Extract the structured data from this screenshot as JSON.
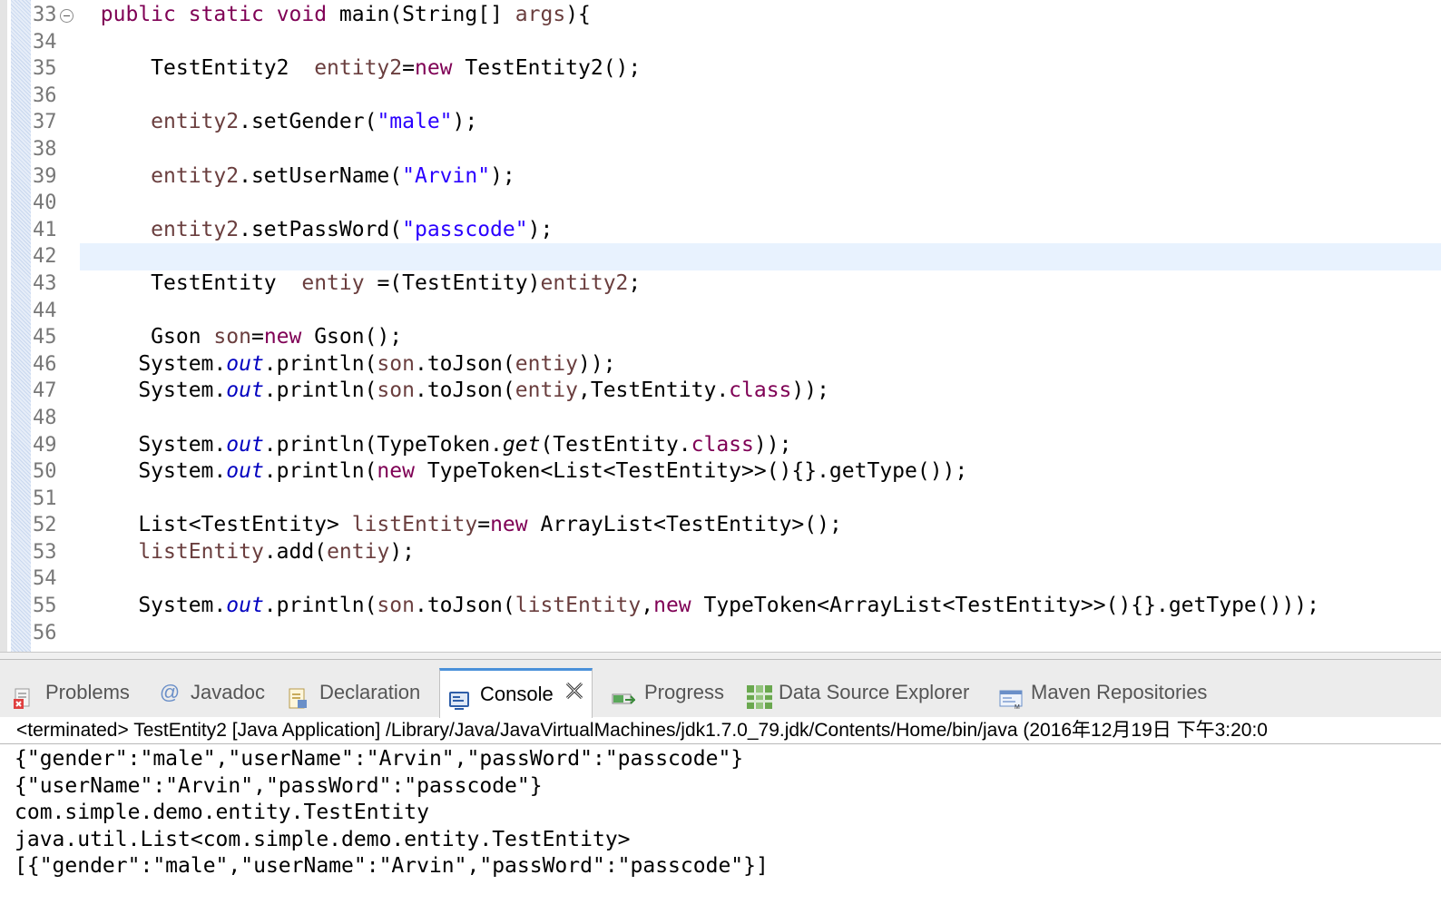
{
  "editor": {
    "lines": [
      {
        "n": "33",
        "tokens": [
          {
            "t": "        "
          },
          {
            "t": "public",
            "c": "kw"
          },
          {
            "t": " "
          },
          {
            "t": "static",
            "c": "kw"
          },
          {
            "t": " "
          },
          {
            "t": "void",
            "c": "kw"
          },
          {
            "t": " main(String[] "
          },
          {
            "t": "args",
            "c": "var"
          },
          {
            "t": "){"
          }
        ]
      },
      {
        "n": "34",
        "tokens": []
      },
      {
        "n": "35",
        "tokens": [
          {
            "t": "            TestEntity2  "
          },
          {
            "t": "entity2",
            "c": "var"
          },
          {
            "t": "="
          },
          {
            "t": "new",
            "c": "kw"
          },
          {
            "t": " TestEntity2();"
          }
        ]
      },
      {
        "n": "36",
        "tokens": []
      },
      {
        "n": "37",
        "tokens": [
          {
            "t": "            "
          },
          {
            "t": "entity2",
            "c": "var"
          },
          {
            "t": ".setGender("
          },
          {
            "t": "\"male\"",
            "c": "str"
          },
          {
            "t": ");"
          }
        ]
      },
      {
        "n": "38",
        "tokens": []
      },
      {
        "n": "39",
        "tokens": [
          {
            "t": "            "
          },
          {
            "t": "entity2",
            "c": "var"
          },
          {
            "t": ".setUserName("
          },
          {
            "t": "\"Arvin\"",
            "c": "str"
          },
          {
            "t": ");"
          }
        ]
      },
      {
        "n": "40",
        "tokens": []
      },
      {
        "n": "41",
        "tokens": [
          {
            "t": "            "
          },
          {
            "t": "entity2",
            "c": "var"
          },
          {
            "t": ".setPassWord("
          },
          {
            "t": "\"passcode\"",
            "c": "str"
          },
          {
            "t": ");"
          }
        ]
      },
      {
        "n": "42",
        "tokens": []
      },
      {
        "n": "43",
        "tokens": [
          {
            "t": "            TestEntity  "
          },
          {
            "t": "entiy",
            "c": "var"
          },
          {
            "t": " =(TestEntity)"
          },
          {
            "t": "entity2",
            "c": "var"
          },
          {
            "t": ";"
          }
        ]
      },
      {
        "n": "44",
        "tokens": []
      },
      {
        "n": "45",
        "tokens": [
          {
            "t": "            Gson "
          },
          {
            "t": "son",
            "c": "var"
          },
          {
            "t": "="
          },
          {
            "t": "new",
            "c": "kw"
          },
          {
            "t": " Gson();"
          }
        ]
      },
      {
        "n": "46",
        "tokens": [
          {
            "t": "           System."
          },
          {
            "t": "out",
            "c": "fld"
          },
          {
            "t": ".println("
          },
          {
            "t": "son",
            "c": "var"
          },
          {
            "t": ".toJson("
          },
          {
            "t": "entiy",
            "c": "var"
          },
          {
            "t": "));"
          }
        ]
      },
      {
        "n": "47",
        "tokens": [
          {
            "t": "           System."
          },
          {
            "t": "out",
            "c": "fld"
          },
          {
            "t": ".println("
          },
          {
            "t": "son",
            "c": "var"
          },
          {
            "t": ".toJson("
          },
          {
            "t": "entiy",
            "c": "var"
          },
          {
            "t": ",TestEntity."
          },
          {
            "t": "class",
            "c": "kw"
          },
          {
            "t": "));"
          }
        ]
      },
      {
        "n": "48",
        "tokens": []
      },
      {
        "n": "49",
        "tokens": [
          {
            "t": "           System."
          },
          {
            "t": "out",
            "c": "fld"
          },
          {
            "t": ".println(TypeToken."
          },
          {
            "t": "get",
            "c": "it"
          },
          {
            "t": "(TestEntity."
          },
          {
            "t": "class",
            "c": "kw"
          },
          {
            "t": "));"
          }
        ]
      },
      {
        "n": "50",
        "tokens": [
          {
            "t": "           System."
          },
          {
            "t": "out",
            "c": "fld"
          },
          {
            "t": ".println("
          },
          {
            "t": "new",
            "c": "kw"
          },
          {
            "t": " TypeToken<List<TestEntity>>(){}.getType());"
          }
        ]
      },
      {
        "n": "51",
        "tokens": []
      },
      {
        "n": "52",
        "tokens": [
          {
            "t": "           List<TestEntity> "
          },
          {
            "t": "listEntity",
            "c": "var"
          },
          {
            "t": "="
          },
          {
            "t": "new",
            "c": "kw"
          },
          {
            "t": " ArrayList<TestEntity>();"
          }
        ]
      },
      {
        "n": "53",
        "tokens": [
          {
            "t": "           "
          },
          {
            "t": "listEntity",
            "c": "var"
          },
          {
            "t": ".add("
          },
          {
            "t": "entiy",
            "c": "var"
          },
          {
            "t": ");"
          }
        ]
      },
      {
        "n": "54",
        "tokens": []
      },
      {
        "n": "55",
        "tokens": [
          {
            "t": "           System."
          },
          {
            "t": "out",
            "c": "fld"
          },
          {
            "t": ".println("
          },
          {
            "t": "son",
            "c": "var"
          },
          {
            "t": ".toJson("
          },
          {
            "t": "listEntity",
            "c": "var"
          },
          {
            "t": ","
          },
          {
            "t": "new",
            "c": "kw"
          },
          {
            "t": " TypeToken<ArrayList<TestEntity>>(){}.getType()));"
          }
        ]
      },
      {
        "n": "56",
        "tokens": []
      }
    ],
    "current_line": "42",
    "folded_line": "33"
  },
  "tabs": [
    {
      "label": "Problems",
      "icon": "problems-icon",
      "active": false
    },
    {
      "label": "Javadoc",
      "icon": "javadoc-icon",
      "active": false
    },
    {
      "label": "Declaration",
      "icon": "declaration-icon",
      "active": false
    },
    {
      "label": "Console",
      "icon": "console-icon",
      "active": true
    },
    {
      "label": "Progress",
      "icon": "progress-icon",
      "active": false
    },
    {
      "label": "Data Source Explorer",
      "icon": "data-source-icon",
      "active": false
    },
    {
      "label": "Maven Repositories",
      "icon": "maven-icon",
      "active": false
    }
  ],
  "console": {
    "status": "<terminated> TestEntity2 [Java Application] /Library/Java/JavaVirtualMachines/jdk1.7.0_79.jdk/Contents/Home/bin/java (2016年12月19日 下午3:20:0",
    "output": [
      "{\"gender\":\"male\",\"userName\":\"Arvin\",\"passWord\":\"passcode\"}",
      "{\"userName\":\"Arvin\",\"passWord\":\"passcode\"}",
      "com.simple.demo.entity.TestEntity",
      "java.util.List<com.simple.demo.entity.TestEntity>",
      "[{\"gender\":\"male\",\"userName\":\"Arvin\",\"passWord\":\"passcode\"}]"
    ]
  },
  "colors": {
    "keyword": "#7f0055",
    "string": "#2a00ff",
    "field": "#0000c0",
    "local_var": "#6a3e3e",
    "current_line": "#e8f2fe",
    "active_tab_accent": "#4a90d9"
  }
}
